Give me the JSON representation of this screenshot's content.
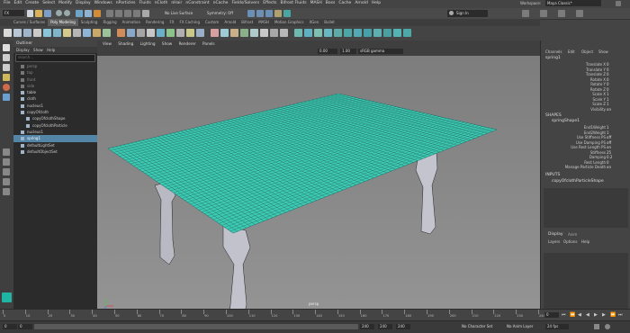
{
  "menubar": {
    "items": [
      "File",
      "Edit",
      "Create",
      "Select",
      "Modify",
      "Display",
      "Windows",
      "nParticles",
      "Fluids",
      "nCloth",
      "nHair",
      "nConstraint",
      "nCache",
      "Fields/Solvers",
      "Effects",
      "Bifrost Fluids",
      "MASH",
      "Boss",
      "Cache",
      "Arnold",
      "Help"
    ],
    "workspace_label": "Workspace:",
    "workspace_value": "Maya Classic*"
  },
  "statusline": {
    "mode": "FX",
    "no_live_surface": "No Live Surface",
    "symmetry": "Symmetry: Off",
    "sign_in": "Sign In"
  },
  "shelf_tabs": [
    "Curves / Surfaces",
    "Poly Modeling",
    "Sculpting",
    "Rigging",
    "Animation",
    "Rendering",
    "FX",
    "FX Caching",
    "Custom",
    "Arnold",
    "Bifrost",
    "MASH",
    "Motion Graphics",
    "XGen",
    "Bullet"
  ],
  "shelf_active": "Poly Modeling",
  "outliner": {
    "title": "Outliner",
    "menu": [
      "Display",
      "Show",
      "Help"
    ],
    "search_placeholder": "search...",
    "rows": [
      {
        "label": "persp",
        "dim": true
      },
      {
        "label": "top",
        "dim": true
      },
      {
        "label": "front",
        "dim": true
      },
      {
        "label": "side",
        "dim": true
      },
      {
        "label": "table",
        "dim": false
      },
      {
        "label": "cloth",
        "dim": false
      },
      {
        "label": "nucleus1",
        "dim": false
      },
      {
        "label": "copyOfcloth",
        "dim": false
      },
      {
        "label": "copyOfclothShape",
        "dim": false
      },
      {
        "label": "copyOfclothParticle",
        "dim": false
      },
      {
        "label": "nucleus1",
        "dim": false
      },
      {
        "label": "spring1",
        "dim": false
      },
      {
        "label": "defaultLightSet",
        "dim": false
      },
      {
        "label": "defaultObjectSet",
        "dim": false
      }
    ],
    "selected_index": 11
  },
  "viewport": {
    "menu": [
      "View",
      "Shading",
      "Lighting",
      "Show",
      "Renderer",
      "Panels"
    ],
    "field_value": "0.00",
    "field_value2": "1.00",
    "color_space": "sRGB gamma",
    "camera_label": "persp",
    "mesh_color": "#3dcbb4",
    "background": "#858585"
  },
  "channelbox": {
    "tabs": [
      "Channels",
      "Edit",
      "Object",
      "Show"
    ],
    "object_name": "spring1",
    "channels": [
      {
        "label": "Translate X",
        "value": "0"
      },
      {
        "label": "Translate Y",
        "value": "0"
      },
      {
        "label": "Translate Z",
        "value": "0"
      },
      {
        "label": "Rotate X",
        "value": "0"
      },
      {
        "label": "Rotate Y",
        "value": "0"
      },
      {
        "label": "Rotate Z",
        "value": "0"
      },
      {
        "label": "Scale X",
        "value": "1"
      },
      {
        "label": "Scale Y",
        "value": "1"
      },
      {
        "label": "Scale Z",
        "value": "1"
      },
      {
        "label": "Visibility",
        "value": "on"
      }
    ],
    "shapes_header": "SHAPES",
    "shape_name": "springShape1",
    "shape_channels": [
      {
        "label": "End1Weight",
        "value": "1"
      },
      {
        "label": "End2Weight",
        "value": "1"
      },
      {
        "label": "Use Stiffness PS",
        "value": "off"
      },
      {
        "label": "Use Damping PS",
        "value": "off"
      },
      {
        "label": "Use Rest Length PS",
        "value": "on"
      },
      {
        "label": "Stiffness",
        "value": "25"
      },
      {
        "label": "Damping",
        "value": "0.2"
      },
      {
        "label": "Rest Length",
        "value": "0"
      },
      {
        "label": "Manage Particle Death",
        "value": "on"
      }
    ],
    "inputs_header": "INPUTS",
    "input_name": "copyOfclothParticleShape"
  },
  "layer_editor": {
    "tabs": [
      "Display",
      "Anim"
    ],
    "menu": [
      "Layers",
      "Options",
      "Help"
    ]
  },
  "timeline": {
    "ticks": [
      "0",
      "10",
      "20",
      "30",
      "40",
      "50",
      "60",
      "70",
      "80",
      "90",
      "100",
      "110",
      "120",
      "130",
      "140",
      "150",
      "160",
      "170",
      "180",
      "190",
      "200",
      "210",
      "220",
      "230",
      "240"
    ],
    "current_frame": "0",
    "range_start": "0",
    "range_inner_start": "0",
    "range_end": "240",
    "range_outer_end": "240",
    "range_end2": "240",
    "character_set": "No Character Set",
    "anim_layer": "No Anim Layer",
    "fps": "24 fps"
  }
}
